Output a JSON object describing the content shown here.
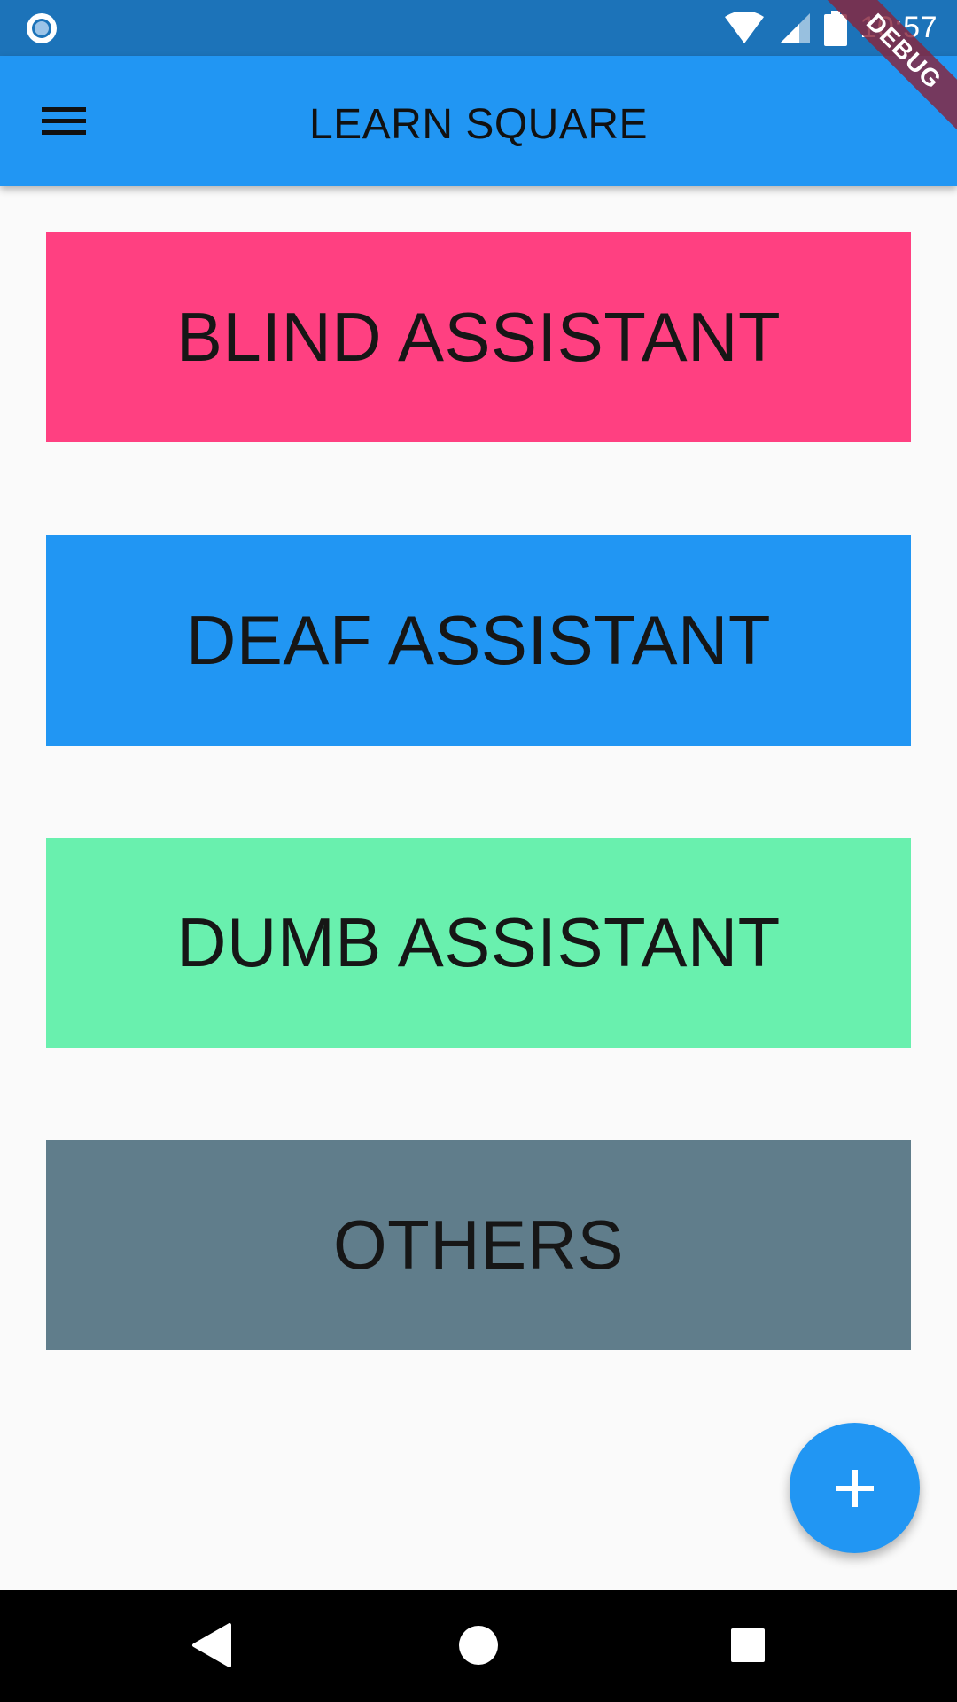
{
  "status_bar": {
    "time": "10:57",
    "background_color": "#1c73b9",
    "left_icon": "radio-circle-icon",
    "icons": [
      "wifi-icon",
      "signal-icon",
      "battery-icon"
    ]
  },
  "app_bar": {
    "title": "LEARN SQUARE",
    "menu_icon": "hamburger-menu-icon",
    "background_color": "#2196f3"
  },
  "debug_banner": {
    "label": "DEBUG"
  },
  "tiles": [
    {
      "label": "BLIND ASSISTANT",
      "color": "#ff4081"
    },
    {
      "label": "DEAF ASSISTANT",
      "color": "#2196f3"
    },
    {
      "label": "DUMB ASSISTANT",
      "color": "#69f0ae"
    },
    {
      "label": "OTHERS",
      "color": "#607d8b"
    }
  ],
  "fab": {
    "icon": "plus-icon",
    "color": "#2196f3"
  },
  "nav_bar": {
    "buttons": [
      "back-icon",
      "home-icon",
      "recents-icon"
    ]
  }
}
